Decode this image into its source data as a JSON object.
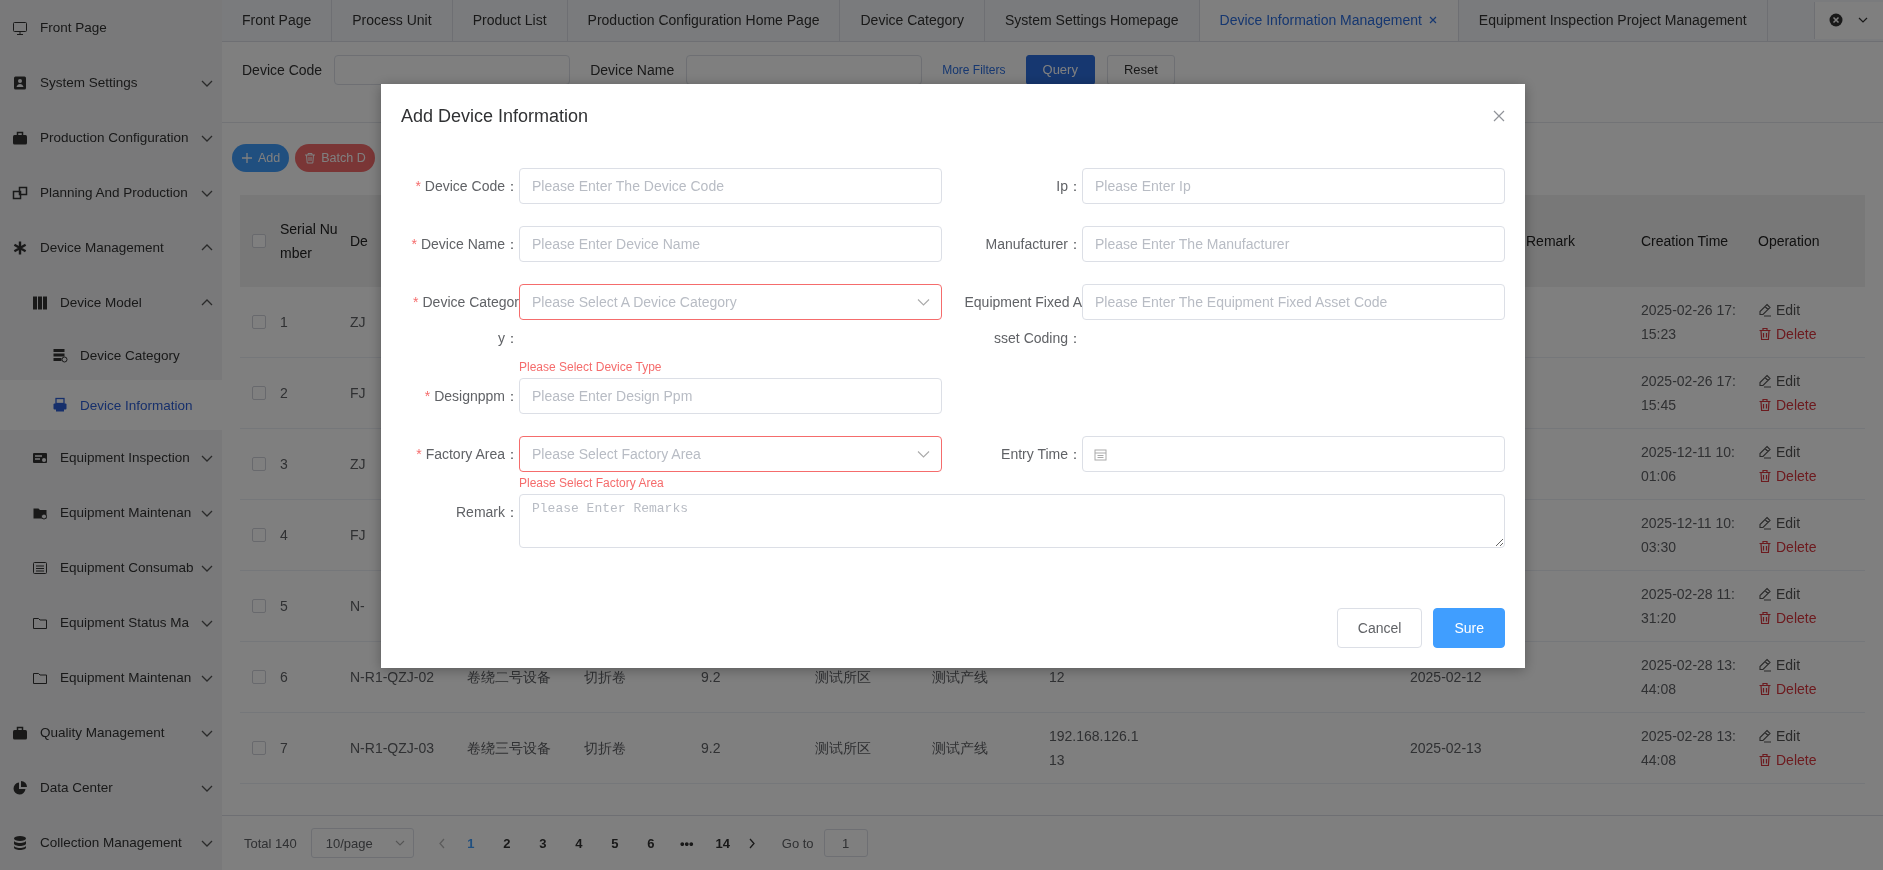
{
  "sidebar": {
    "items": [
      {
        "label": "Front Page",
        "selected": false
      },
      {
        "label": "System Settings",
        "selected": false,
        "expanded": false
      },
      {
        "label": "Production Configuration",
        "selected": false,
        "expanded": false
      },
      {
        "label": "Planning And Production",
        "selected": false,
        "expanded": false
      },
      {
        "label": "Device Management",
        "selected": false,
        "expanded": true,
        "children": [
          {
            "label": "Device Model",
            "selected": false,
            "expanded": true,
            "children": [
              {
                "label": "Device Category",
                "selected": false
              },
              {
                "label": "Device Information",
                "selected": true
              }
            ]
          },
          {
            "label": "Equipment Inspection",
            "selected": false,
            "expanded": false
          },
          {
            "label": "Equipment Maintenan",
            "selected": false,
            "expanded": false
          },
          {
            "label": "Equipment Consumab",
            "selected": false,
            "expanded": false
          },
          {
            "label": "Equipment Status Ma",
            "selected": false,
            "expanded": false
          },
          {
            "label": "Equipment Maintenan",
            "selected": false,
            "expanded": false
          }
        ]
      },
      {
        "label": "Quality Management",
        "selected": false,
        "expanded": false
      },
      {
        "label": "Data Center",
        "selected": false,
        "expanded": false
      },
      {
        "label": "Collection Management",
        "selected": false,
        "expanded": false
      }
    ]
  },
  "tabs": [
    {
      "label": "Front Page",
      "selected": false
    },
    {
      "label": "Process Unit",
      "selected": false
    },
    {
      "label": "Product List",
      "selected": false
    },
    {
      "label": "Production Configuration Home Page",
      "selected": false
    },
    {
      "label": "Device Category",
      "selected": false
    },
    {
      "label": "System Settings Homepage",
      "selected": false
    },
    {
      "label": "Device Information Management",
      "selected": true
    },
    {
      "label": "Equipment Inspection Project Management",
      "selected": false
    }
  ],
  "filters": {
    "fields": [
      {
        "label": "Device Code"
      },
      {
        "label": "Device Name"
      }
    ],
    "more_filters": "More Filters",
    "query": "Query",
    "reset": "Reset"
  },
  "actions": [
    {
      "label": "Add",
      "kind": "primary"
    },
    {
      "label": "Batch D",
      "kind": "danger"
    }
  ],
  "table": {
    "all_selected": false,
    "columns": {
      "column_1": "Serial Number",
      "column_2": "De",
      "column_11": "Remark",
      "column_12": "Creation Time",
      "operation": "Operation"
    },
    "rows": [
      {
        "selected": false,
        "column_1": "1",
        "column_2": "ZJ",
        "column_12": "2025-02-26 17:15:23",
        "actions": [
          {
            "label": "Edit",
            "kind": "edit"
          },
          {
            "label": "Delete",
            "kind": "delete"
          }
        ]
      },
      {
        "selected": false,
        "column_1": "2",
        "column_2": "FJ",
        "column_12": "2025-02-26 17:15:45",
        "actions": [
          {
            "label": "Edit",
            "kind": "edit"
          },
          {
            "label": "Delete",
            "kind": "delete"
          }
        ]
      },
      {
        "selected": false,
        "column_1": "3",
        "column_2": "ZJ",
        "column_12": "2025-12-11 10:01:06",
        "actions": [
          {
            "label": "Edit",
            "kind": "edit"
          },
          {
            "label": "Delete",
            "kind": "delete"
          }
        ]
      },
      {
        "selected": false,
        "column_1": "4",
        "column_2": "FJ",
        "column_12": "2025-12-11 10:03:30",
        "actions": [
          {
            "label": "Edit",
            "kind": "edit"
          },
          {
            "label": "Delete",
            "kind": "delete"
          }
        ]
      },
      {
        "selected": false,
        "column_1": "5",
        "column_2": "N-",
        "column_12": "2025-02-28 11:31:20",
        "actions": [
          {
            "label": "Edit",
            "kind": "edit"
          },
          {
            "label": "Delete",
            "kind": "delete"
          }
        ]
      },
      {
        "selected": false,
        "column_1": "6",
        "column_2": "N-R1-QZJ-02",
        "column_3": "卷绕二号设备",
        "column_4": "切折卷",
        "column_5": "9.2",
        "column_6": "测试所区",
        "column_7": "测试产线",
        "column_8": "12",
        "column_10": "2025-02-12",
        "column_12": "2025-02-28 13:44:08",
        "actions": [
          {
            "label": "Edit",
            "kind": "edit"
          },
          {
            "label": "Delete",
            "kind": "delete"
          }
        ]
      },
      {
        "selected": false,
        "column_1": "7",
        "column_2": "N-R1-QZJ-03",
        "column_3": "卷绕三号设备",
        "column_4": "切折卷",
        "column_5": "9.2",
        "column_6": "测试所区",
        "column_7": "测试产线",
        "column_8": "192.168.126.113",
        "column_10": "2025-02-13",
        "column_12": "2025-02-28 13:44:08",
        "actions": [
          {
            "label": "Edit",
            "kind": "edit"
          },
          {
            "label": "Delete",
            "kind": "delete"
          }
        ]
      }
    ]
  },
  "pagination": {
    "total": "Total 140",
    "page_size": "10/page",
    "prev_disabled": true,
    "pages": [
      {
        "label": "1",
        "selected": true
      },
      {
        "label": "2",
        "selected": false
      },
      {
        "label": "3",
        "selected": false
      },
      {
        "label": "4",
        "selected": false
      },
      {
        "label": "5",
        "selected": false
      },
      {
        "label": "6",
        "selected": false
      },
      {
        "label": "•••",
        "selected": false
      },
      {
        "label": "14",
        "selected": false
      }
    ],
    "goto_label": "Go to",
    "goto_value": "1"
  },
  "dialog": {
    "title": "Add Device Information",
    "rows": [
      [
        {
          "label": "Device Code：",
          "marker": "*",
          "kind": "input",
          "placeholder": "Please Enter The Device Code"
        },
        {
          "label": "Ip：",
          "kind": "input",
          "placeholder": "Please Enter Ip"
        }
      ],
      [
        {
          "label": "Device Name：",
          "marker": "*",
          "kind": "input",
          "placeholder": "Please Enter Device Name"
        },
        {
          "label": "Manufacturer：",
          "kind": "input",
          "placeholder": "Please Enter The Manufacturer"
        }
      ],
      [
        {
          "label": "Device Category：",
          "marker": "*",
          "kind": "select",
          "placeholder": "Please Select A Device Category",
          "error": "Please Select Device Type"
        },
        {
          "label": "Equipment Fixed Asset Coding：",
          "kind": "input",
          "placeholder": "Please Enter The Equipment Fixed Asset Code"
        }
      ],
      [
        {
          "label": "Designppm：",
          "marker": "*",
          "kind": "input",
          "placeholder": "Please Enter Design Ppm"
        }
      ],
      [
        {
          "label": "Factory Area：",
          "marker": "*",
          "kind": "select",
          "placeholder": "Please Select Factory Area",
          "error": "Please Select Factory Area"
        },
        {
          "label": "Entry Time：",
          "kind": "date"
        }
      ],
      [
        {
          "label": "Remark：",
          "kind": "textarea",
          "placeholder": "Please Enter Remarks"
        }
      ]
    ],
    "buttons": [
      {
        "label": "Cancel",
        "kind": "default"
      },
      {
        "label": "Sure",
        "kind": "primary"
      }
    ]
  }
}
